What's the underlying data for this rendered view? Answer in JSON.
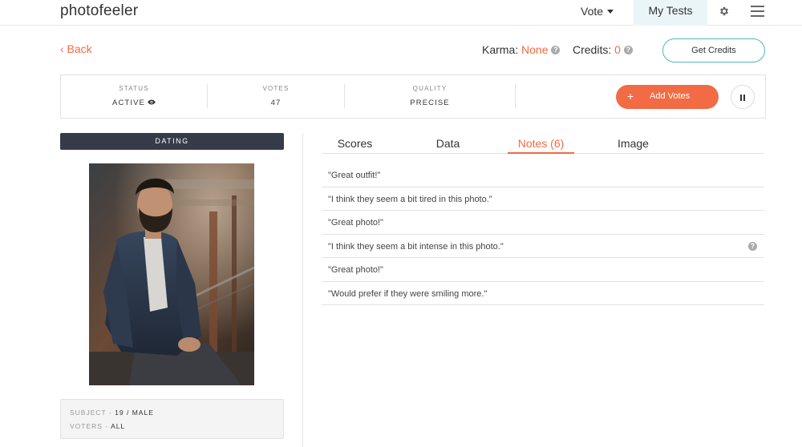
{
  "app": {
    "logo": "photofeeler"
  },
  "nav": {
    "vote_label": "Vote",
    "my_tests_label": "My Tests",
    "gear_icon": "gear-icon",
    "menu_icon": "hamburger-menu-icon"
  },
  "subheader": {
    "back_label": "‹ Back",
    "karma_label": "Karma:",
    "karma_value": "None",
    "credits_label": "Credits:",
    "credits_value": "0",
    "get_credits_label": "Get Credits"
  },
  "stats": {
    "status_label": "STATUS",
    "status_value": "ACTIVE",
    "votes_label": "VOTES",
    "votes_value": "47",
    "quality_label": "QUALITY",
    "quality_value": "PRECISE",
    "add_votes_plus": "+",
    "add_votes_label": "Add Votes"
  },
  "test": {
    "category": "DATING",
    "subject_key": "SUBJECT",
    "subject_value": "19 / MALE",
    "voters_key": "VOTERS",
    "voters_value": "ALL",
    "separator": "-"
  },
  "tabs": [
    {
      "label": "Scores",
      "active": false
    },
    {
      "label": "Data",
      "active": false
    },
    {
      "label": "Notes (6)",
      "active": true
    },
    {
      "label": "Image",
      "active": false
    }
  ],
  "notes": [
    {
      "text": "\"Great outfit!\"",
      "help": false
    },
    {
      "text": "\"I think they seem a bit tired in this photo.\"",
      "help": false
    },
    {
      "text": "\"Great photo!\"",
      "help": false
    },
    {
      "text": "\"I think they seem a bit intense in this photo.\"",
      "help": true
    },
    {
      "text": "\"Great photo!\"",
      "help": false
    },
    {
      "text": "\"Would prefer if they were smiling more.\"",
      "help": false
    }
  ],
  "colors": {
    "accent": "#f26b44",
    "dark_bar": "#353b48",
    "outline_teal": "#4fb5c4",
    "highlight_tab_bg": "#eaf5f7"
  }
}
